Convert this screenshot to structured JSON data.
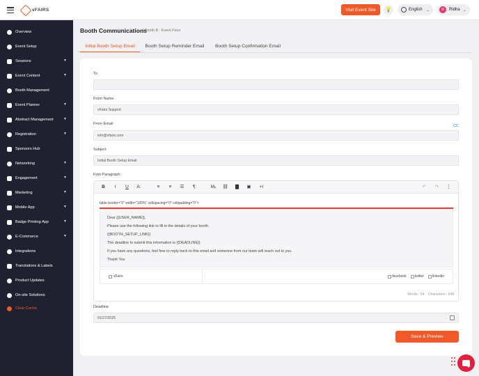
{
  "header": {
    "logo_text": "vFAIRS",
    "visit_label": "Visit Event Site",
    "language": "English",
    "user_initial": "R",
    "user_name": "Ridha"
  },
  "sidebar": {
    "items": [
      {
        "label": "Overview",
        "has_caret": false
      },
      {
        "label": "Event Setup",
        "has_caret": false
      },
      {
        "label": "Sessions",
        "has_caret": true
      },
      {
        "label": "Event Content",
        "has_caret": true
      },
      {
        "label": "Booth Management",
        "has_caret": false
      },
      {
        "label": "Event Planner",
        "has_caret": true
      },
      {
        "label": "Abstract Management",
        "has_caret": true
      },
      {
        "label": "Registration",
        "has_caret": true
      },
      {
        "label": "Sponsors Hub",
        "has_caret": false
      },
      {
        "label": "Networking",
        "has_caret": true
      },
      {
        "label": "Engagement",
        "has_caret": true
      },
      {
        "label": "Marketing",
        "has_caret": true
      },
      {
        "label": "Mobile App",
        "has_caret": true
      },
      {
        "label": "Badge Printing App",
        "has_caret": true
      },
      {
        "label": "E-Commerce",
        "has_caret": true
      },
      {
        "label": "Integrations",
        "has_caret": false
      },
      {
        "label": "Translations & Labels",
        "has_caret": false
      },
      {
        "label": "Product Updates",
        "has_caret": false
      },
      {
        "label": "On-site Solutions",
        "has_caret": false
      },
      {
        "label": "Clear Cache",
        "has_caret": false
      }
    ],
    "accent_color": "#ef5a28"
  },
  "page": {
    "title": "Booth Communications",
    "subtitle": "| Booth B - Event Floor",
    "tabs": [
      {
        "label": "Initial Booth Setup Email",
        "active": true
      },
      {
        "label": "Booth Setup Reminder Email",
        "active": false
      },
      {
        "label": "Booth Setup Confirmation Email",
        "active": false
      }
    ]
  },
  "form": {
    "to_label": "To",
    "to_value": "",
    "from_name_label": "From Name",
    "from_name_value": "vFairs Support",
    "from_email_label": "From Email",
    "from_email_value": "info@vfairs.com",
    "cc_label": "CC",
    "subject_label": "Subject",
    "subject_value": "Initial Booth Setup Email",
    "first_paragraph_label": "First Paragraph",
    "deadline_label": "Deadline",
    "deadline_value": "01/27/2025",
    "save_label": "Save & Preview"
  },
  "editor": {
    "toolbar": [
      "B",
      "I",
      "U",
      "A:",
      "≡",
      "≡",
      "☰",
      "¶:",
      "Mₓ",
      "⛓",
      "▇",
      "▣",
      "+I"
    ],
    "code_line": "table border=\"0\" width=\"100%\" cellspacing=\"0\" cellpadding=\"0\">",
    "body_lines": [
      "Dear {{USER_NAME}},",
      "Please use the following link to fill in the details of your booth.",
      "{{BOOTH_SETUP_LINK}}",
      "The deadline to submit this information is {{DEADLINE}}",
      "If you have any questions, feel free to reply back to this email and someone from our team will reach out to you.",
      "Thank You"
    ],
    "footer_logo_alt": "vFairs",
    "social": [
      "facebook",
      "twitter",
      "linkedin"
    ],
    "words": "Words : 54",
    "characters": "Characters : 348"
  }
}
